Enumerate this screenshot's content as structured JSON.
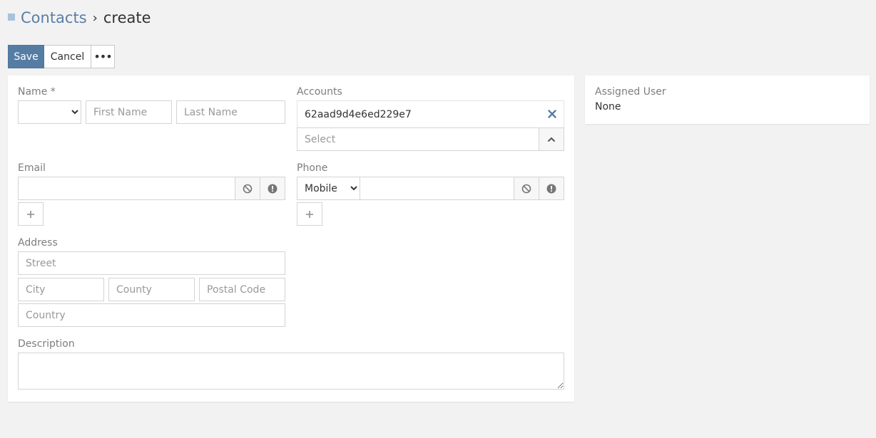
{
  "header": {
    "module_link": "Contacts",
    "separator": "›",
    "current": "create"
  },
  "toolbar": {
    "save_label": "Save",
    "cancel_label": "Cancel",
    "more_label": "•••"
  },
  "form": {
    "name": {
      "label": "Name *",
      "salutation_value": "",
      "first_name_placeholder": "First Name",
      "last_name_placeholder": "Last Name"
    },
    "accounts": {
      "label": "Accounts",
      "selected": "62aad9d4e6ed229e7",
      "select_placeholder": "Select"
    },
    "email": {
      "label": "Email",
      "value": ""
    },
    "phone": {
      "label": "Phone",
      "type_selected": "Mobile",
      "value": ""
    },
    "address": {
      "label": "Address",
      "street_placeholder": "Street",
      "city_placeholder": "City",
      "county_placeholder": "County",
      "postal_code_placeholder": "Postal Code",
      "country_placeholder": "Country"
    },
    "description": {
      "label": "Description",
      "value": ""
    }
  },
  "side": {
    "assigned_user_label": "Assigned User",
    "assigned_user_value": "None"
  },
  "colors": {
    "primary": "#557da4",
    "link": "#5a7ea6",
    "background": "#f2f2f2"
  }
}
